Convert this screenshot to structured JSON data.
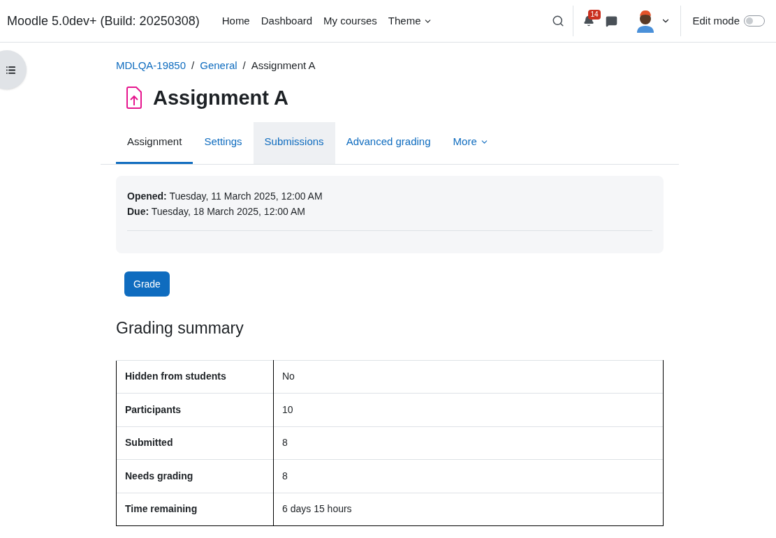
{
  "navbar": {
    "brand": "Moodle 5.0dev+ (Build: 20250308)",
    "links": [
      "Home",
      "Dashboard",
      "My courses"
    ],
    "theme_menu": "Theme",
    "notification_count": "14",
    "edit_mode": {
      "label": "Edit mode",
      "on": false
    }
  },
  "breadcrumb": {
    "separator": "/",
    "items": [
      {
        "label": "MDLQA-19850",
        "link": true
      },
      {
        "label": "General",
        "link": true
      },
      {
        "label": "Assignment A",
        "link": false
      }
    ]
  },
  "page_title": "Assignment A",
  "tabs": [
    {
      "label": "Assignment",
      "selected": true,
      "hovered": false
    },
    {
      "label": "Settings",
      "selected": false,
      "hovered": false
    },
    {
      "label": "Submissions",
      "selected": false,
      "hovered": true
    },
    {
      "label": "Advanced grading",
      "selected": false,
      "hovered": false
    }
  ],
  "more_tab": "More",
  "dates": [
    {
      "label": "Opened:",
      "value": "Tuesday, 11 March 2025, 12:00 AM"
    },
    {
      "label": "Due:",
      "value": "Tuesday, 18 March 2025, 12:00 AM"
    }
  ],
  "grade_button": "Grade",
  "summary": {
    "heading": "Grading summary",
    "rows": [
      {
        "label": "Hidden from students",
        "value": "No"
      },
      {
        "label": "Participants",
        "value": "10"
      },
      {
        "label": "Submitted",
        "value": "8"
      },
      {
        "label": "Needs grading",
        "value": "8"
      },
      {
        "label": "Time remaining",
        "value": "6 days 15 hours"
      }
    ]
  }
}
